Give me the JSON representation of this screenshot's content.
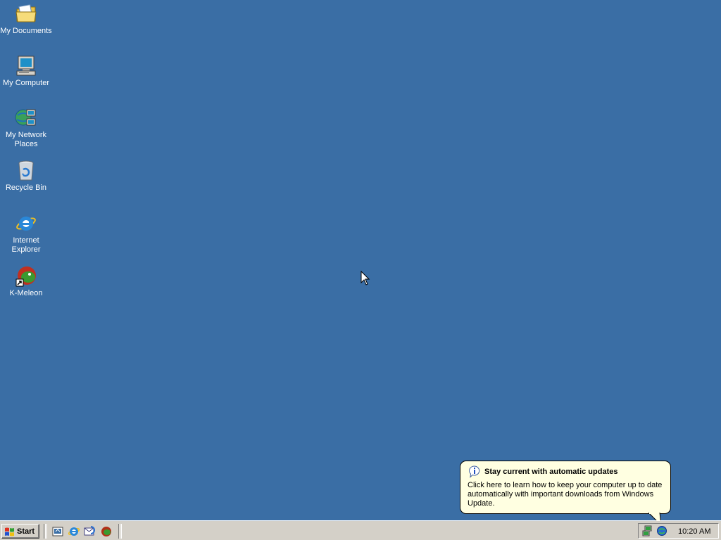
{
  "desktop": {
    "background": "#3a6ea5",
    "icons": [
      {
        "name": "my-documents",
        "label": "My Documents",
        "icon": "folder-documents-icon"
      },
      {
        "name": "my-computer",
        "label": "My Computer",
        "icon": "computer-icon"
      },
      {
        "name": "my-network-places",
        "label": "My Network Places",
        "icon": "network-places-icon"
      },
      {
        "name": "recycle-bin",
        "label": "Recycle Bin",
        "icon": "recycle-bin-icon"
      },
      {
        "name": "internet-explorer",
        "label": "Internet Explorer",
        "icon": "internet-explorer-icon"
      },
      {
        "name": "k-meleon",
        "label": "K-Meleon",
        "icon": "k-meleon-icon"
      }
    ]
  },
  "balloon": {
    "title": "Stay current with automatic updates",
    "body": "Click here to learn how to keep your computer up to date automatically with important downloads from Windows Update.",
    "icon": "info-icon"
  },
  "taskbar": {
    "start_label": "Start",
    "quick_launch": [
      "show-desktop-icon",
      "internet-explorer-icon",
      "outlook-express-icon",
      "k-meleon-icon"
    ],
    "tray_icons": [
      "network-connection-icon",
      "windows-update-icon"
    ],
    "clock": "10:20 AM"
  }
}
